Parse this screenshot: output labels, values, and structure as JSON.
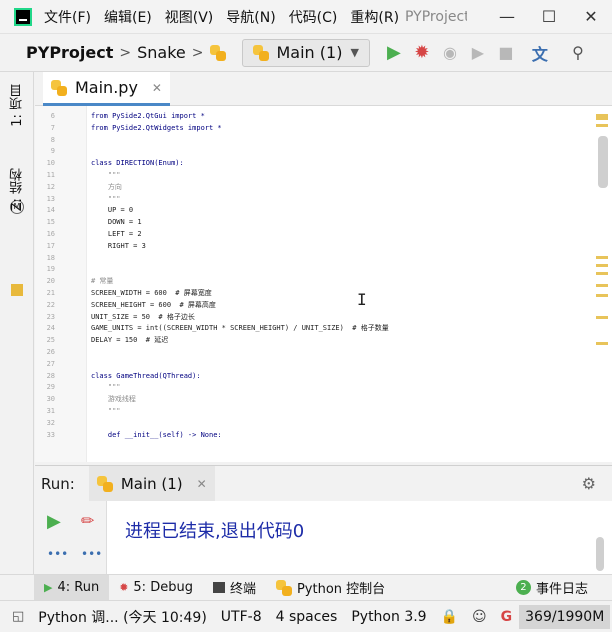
{
  "menu": [
    "文件(F)",
    "编辑(E)",
    "视图(V)",
    "导航(N)",
    "代码(C)",
    "重构(R)"
  ],
  "window_title": "PYProject",
  "breadcrumb": {
    "project": "PYProject",
    "folder": "Snake"
  },
  "run_config": {
    "label": "Main (1)"
  },
  "left_tabs": {
    "project": "1: 项目",
    "structure": "Z: 结构"
  },
  "editor": {
    "file_tab": "Main.py",
    "lines": [
      {
        "n": "6",
        "text": "from PySide2.QtGui import *"
      },
      {
        "n": "7",
        "text": "from PySide2.QtWidgets import *"
      },
      {
        "n": "8",
        "text": ""
      },
      {
        "n": "9",
        "text": ""
      },
      {
        "n": "10",
        "text": "class DIRECTION(Enum):"
      },
      {
        "n": "11",
        "text": "    \"\"\""
      },
      {
        "n": "12",
        "text": "    方向"
      },
      {
        "n": "13",
        "text": "    \"\"\""
      },
      {
        "n": "14",
        "text": "    UP = 0"
      },
      {
        "n": "15",
        "text": "    DOWN = 1"
      },
      {
        "n": "16",
        "text": "    LEFT = 2"
      },
      {
        "n": "17",
        "text": "    RIGHT = 3"
      },
      {
        "n": "18",
        "text": ""
      },
      {
        "n": "19",
        "text": ""
      },
      {
        "n": "20",
        "text": "# 常量"
      },
      {
        "n": "21",
        "text": "SCREEN_WIDTH = 600  # 屏幕宽度"
      },
      {
        "n": "22",
        "text": "SCREEN_HEIGHT = 600  # 屏幕高度"
      },
      {
        "n": "23",
        "text": "UNIT_SIZE = 50  # 格子边长"
      },
      {
        "n": "24",
        "text": "GAME_UNITS = int((SCREEN_WIDTH * SCREEN_HEIGHT) / UNIT_SIZE)  # 格子数量"
      },
      {
        "n": "25",
        "text": "DELAY = 150  # 延迟"
      },
      {
        "n": "26",
        "text": ""
      },
      {
        "n": "27",
        "text": ""
      },
      {
        "n": "28",
        "text": "class GameThread(QThread):"
      },
      {
        "n": "29",
        "text": "    \"\"\""
      },
      {
        "n": "30",
        "text": "    游戏线程"
      },
      {
        "n": "31",
        "text": "    \"\"\""
      },
      {
        "n": "32",
        "text": ""
      },
      {
        "n": "33",
        "text": "    def __init__(self) -> None:"
      }
    ]
  },
  "run_panel": {
    "title": "Run:",
    "tab_label": "Main (1)",
    "output": "进程已结束,退出代码0"
  },
  "bottom_tabs": {
    "run": "4: Run",
    "debug": "5: Debug",
    "terminal": "终端",
    "python_console": "Python 控制台",
    "event_log": "事件日志",
    "event_count": "2"
  },
  "status": {
    "message": "Python 调... (今天 10:49)",
    "encoding": "UTF-8",
    "indent": "4 spaces",
    "interpreter": "Python 3.9",
    "memory": "369/1990M"
  },
  "colors": {
    "accent": "#4a88c7",
    "run_green": "#4caf50",
    "debug_red": "#d64545",
    "output_blue": "#1d2ca8"
  }
}
